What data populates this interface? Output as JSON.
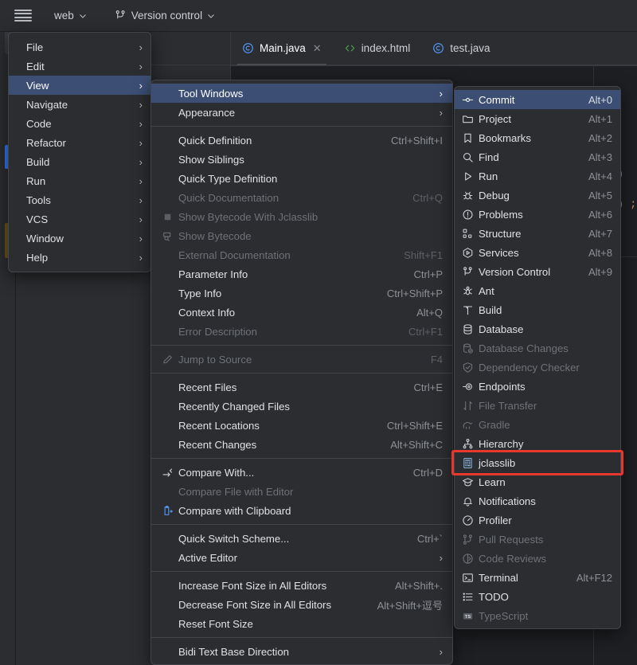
{
  "toolbar": {
    "hamburger": "main-menu-icon",
    "project_name": "web",
    "vcs_label": "Version control"
  },
  "tabs": [
    {
      "label": "Main.java",
      "icon": "java-class-icon",
      "active": true,
      "closable": true
    },
    {
      "label": "index.html",
      "icon": "html-file-icon",
      "active": false,
      "closable": false
    },
    {
      "label": "test.java",
      "icon": "java-class-icon",
      "active": false,
      "closable": false
    }
  ],
  "editor": {
    "fragment_1": ")",
    "fragment_2": ");"
  },
  "main_menu": {
    "items": [
      {
        "label": "File",
        "submenu": true,
        "selected": false
      },
      {
        "label": "Edit",
        "submenu": true,
        "selected": false
      },
      {
        "label": "View",
        "submenu": true,
        "selected": true
      },
      {
        "label": "Navigate",
        "submenu": true,
        "selected": false
      },
      {
        "label": "Code",
        "submenu": true,
        "selected": false
      },
      {
        "label": "Refactor",
        "submenu": true,
        "selected": false
      },
      {
        "label": "Build",
        "submenu": true,
        "selected": false
      },
      {
        "label": "Run",
        "submenu": true,
        "selected": false
      },
      {
        "label": "Tools",
        "submenu": true,
        "selected": false
      },
      {
        "label": "VCS",
        "submenu": true,
        "selected": false
      },
      {
        "label": "Window",
        "submenu": true,
        "selected": false
      },
      {
        "label": "Help",
        "submenu": true,
        "selected": false
      }
    ]
  },
  "view_menu": {
    "items": [
      {
        "type": "item",
        "label": "Tool Windows",
        "accel": "",
        "icon": "",
        "submenu": true,
        "selected": true,
        "disabled": false
      },
      {
        "type": "item",
        "label": "Appearance",
        "accel": "",
        "icon": "",
        "submenu": true,
        "selected": false,
        "disabled": false
      },
      {
        "type": "sep"
      },
      {
        "type": "item",
        "label": "Quick Definition",
        "accel": "Ctrl+Shift+I",
        "icon": "",
        "submenu": false,
        "selected": false,
        "disabled": false
      },
      {
        "type": "item",
        "label": "Show Siblings",
        "accel": "",
        "icon": "",
        "submenu": false,
        "selected": false,
        "disabled": false
      },
      {
        "type": "item",
        "label": "Quick Type Definition",
        "accel": "",
        "icon": "",
        "submenu": false,
        "selected": false,
        "disabled": false
      },
      {
        "type": "item",
        "label": "Quick Documentation",
        "accel": "Ctrl+Q",
        "icon": "",
        "submenu": false,
        "selected": false,
        "disabled": true
      },
      {
        "type": "item",
        "label": "Show Bytecode With Jclasslib",
        "accel": "",
        "icon": "bytecode-square-icon",
        "submenu": false,
        "selected": false,
        "disabled": true
      },
      {
        "type": "item",
        "label": "Show Bytecode",
        "accel": "",
        "icon": "show-bytecode-icon",
        "submenu": false,
        "selected": false,
        "disabled": true
      },
      {
        "type": "item",
        "label": "External Documentation",
        "accel": "Shift+F1",
        "icon": "",
        "submenu": false,
        "selected": false,
        "disabled": true
      },
      {
        "type": "item",
        "label": "Parameter Info",
        "accel": "Ctrl+P",
        "icon": "",
        "submenu": false,
        "selected": false,
        "disabled": false
      },
      {
        "type": "item",
        "label": "Type Info",
        "accel": "Ctrl+Shift+P",
        "icon": "",
        "submenu": false,
        "selected": false,
        "disabled": false
      },
      {
        "type": "item",
        "label": "Context Info",
        "accel": "Alt+Q",
        "icon": "",
        "submenu": false,
        "selected": false,
        "disabled": false
      },
      {
        "type": "item",
        "label": "Error Description",
        "accel": "Ctrl+F1",
        "icon": "",
        "submenu": false,
        "selected": false,
        "disabled": true
      },
      {
        "type": "sep"
      },
      {
        "type": "item",
        "label": "Jump to Source",
        "accel": "F4",
        "icon": "pencil-icon",
        "submenu": false,
        "selected": false,
        "disabled": true
      },
      {
        "type": "sep"
      },
      {
        "type": "item",
        "label": "Recent Files",
        "accel": "Ctrl+E",
        "icon": "",
        "submenu": false,
        "selected": false,
        "disabled": false
      },
      {
        "type": "item",
        "label": "Recently Changed Files",
        "accel": "",
        "icon": "",
        "submenu": false,
        "selected": false,
        "disabled": false
      },
      {
        "type": "item",
        "label": "Recent Locations",
        "accel": "Ctrl+Shift+E",
        "icon": "",
        "submenu": false,
        "selected": false,
        "disabled": false
      },
      {
        "type": "item",
        "label": "Recent Changes",
        "accel": "Alt+Shift+C",
        "icon": "",
        "submenu": false,
        "selected": false,
        "disabled": false
      },
      {
        "type": "sep"
      },
      {
        "type": "item",
        "label": "Compare With...",
        "accel": "Ctrl+D",
        "icon": "compare-with-icon",
        "submenu": false,
        "selected": false,
        "disabled": false
      },
      {
        "type": "item",
        "label": "Compare File with Editor",
        "accel": "",
        "icon": "",
        "submenu": false,
        "selected": false,
        "disabled": true
      },
      {
        "type": "item",
        "label": "Compare with Clipboard",
        "accel": "",
        "icon": "clipboard-compare-icon",
        "submenu": false,
        "selected": false,
        "disabled": false
      },
      {
        "type": "sep"
      },
      {
        "type": "item",
        "label": "Quick Switch Scheme...",
        "accel": "Ctrl+`",
        "icon": "",
        "submenu": false,
        "selected": false,
        "disabled": false
      },
      {
        "type": "item",
        "label": "Active Editor",
        "accel": "",
        "icon": "",
        "submenu": true,
        "selected": false,
        "disabled": false
      },
      {
        "type": "sep"
      },
      {
        "type": "item",
        "label": "Increase Font Size in All Editors",
        "accel": "Alt+Shift+.",
        "icon": "",
        "submenu": false,
        "selected": false,
        "disabled": false
      },
      {
        "type": "item",
        "label": "Decrease Font Size in All Editors",
        "accel": "Alt+Shift+逗号",
        "icon": "",
        "submenu": false,
        "selected": false,
        "disabled": false
      },
      {
        "type": "item",
        "label": "Reset Font Size",
        "accel": "",
        "icon": "",
        "submenu": false,
        "selected": false,
        "disabled": false
      },
      {
        "type": "sep"
      },
      {
        "type": "item",
        "label": "Bidi Text Base Direction",
        "accel": "",
        "icon": "",
        "submenu": true,
        "selected": false,
        "disabled": false
      }
    ]
  },
  "tool_windows_menu": {
    "items": [
      {
        "label": "Commit",
        "accel": "Alt+0",
        "icon": "commit-icon",
        "selected": true,
        "disabled": false
      },
      {
        "label": "Project",
        "accel": "Alt+1",
        "icon": "folder-icon",
        "selected": false,
        "disabled": false
      },
      {
        "label": "Bookmarks",
        "accel": "Alt+2",
        "icon": "bookmark-icon",
        "selected": false,
        "disabled": false
      },
      {
        "label": "Find",
        "accel": "Alt+3",
        "icon": "search-icon",
        "selected": false,
        "disabled": false
      },
      {
        "label": "Run",
        "accel": "Alt+4",
        "icon": "play-icon",
        "selected": false,
        "disabled": false
      },
      {
        "label": "Debug",
        "accel": "Alt+5",
        "icon": "bug-icon",
        "selected": false,
        "disabled": false
      },
      {
        "label": "Problems",
        "accel": "Alt+6",
        "icon": "exclamation-circle-icon",
        "selected": false,
        "disabled": false
      },
      {
        "label": "Structure",
        "accel": "Alt+7",
        "icon": "structure-icon",
        "selected": false,
        "disabled": false
      },
      {
        "label": "Services",
        "accel": "Alt+8",
        "icon": "services-icon",
        "selected": false,
        "disabled": false
      },
      {
        "label": "Version Control",
        "accel": "Alt+9",
        "icon": "branch-icon",
        "selected": false,
        "disabled": false
      },
      {
        "label": "Ant",
        "accel": "",
        "icon": "ant-icon",
        "selected": false,
        "disabled": false
      },
      {
        "label": "Build",
        "accel": "",
        "icon": "build-hammer-icon",
        "selected": false,
        "disabled": false
      },
      {
        "label": "Database",
        "accel": "",
        "icon": "database-icon",
        "selected": false,
        "disabled": false
      },
      {
        "label": "Database Changes",
        "accel": "",
        "icon": "database-check-icon",
        "selected": false,
        "disabled": true
      },
      {
        "label": "Dependency Checker",
        "accel": "",
        "icon": "shield-check-icon",
        "selected": false,
        "disabled": true
      },
      {
        "label": "Endpoints",
        "accel": "",
        "icon": "endpoints-icon",
        "selected": false,
        "disabled": false
      },
      {
        "label": "File Transfer",
        "accel": "",
        "icon": "transfer-arrows-icon",
        "selected": false,
        "disabled": true
      },
      {
        "label": "Gradle",
        "accel": "",
        "icon": "gradle-elephant-icon",
        "selected": false,
        "disabled": true
      },
      {
        "label": "Hierarchy",
        "accel": "",
        "icon": "hierarchy-icon",
        "selected": false,
        "disabled": false
      },
      {
        "label": "jclasslib",
        "accel": "",
        "icon": "jclasslib-icon",
        "selected": false,
        "disabled": false
      },
      {
        "label": "Learn",
        "accel": "",
        "icon": "graduation-cap-icon",
        "selected": false,
        "disabled": false
      },
      {
        "label": "Notifications",
        "accel": "",
        "icon": "bell-icon",
        "selected": false,
        "disabled": false
      },
      {
        "label": "Profiler",
        "accel": "",
        "icon": "gauge-icon",
        "selected": false,
        "disabled": false
      },
      {
        "label": "Pull Requests",
        "accel": "",
        "icon": "pull-request-icon",
        "selected": false,
        "disabled": true
      },
      {
        "label": "Code Reviews",
        "accel": "",
        "icon": "code-review-icon",
        "selected": false,
        "disabled": true
      },
      {
        "label": "Terminal",
        "accel": "Alt+F12",
        "icon": "terminal-icon",
        "selected": false,
        "disabled": false
      },
      {
        "label": "TODO",
        "accel": "",
        "icon": "todo-list-icon",
        "selected": false,
        "disabled": false
      },
      {
        "label": "TypeScript",
        "accel": "",
        "icon": "typescript-icon",
        "selected": false,
        "disabled": true
      }
    ]
  },
  "annotation": {
    "target": "jclasslib",
    "color": "#e8372c"
  }
}
